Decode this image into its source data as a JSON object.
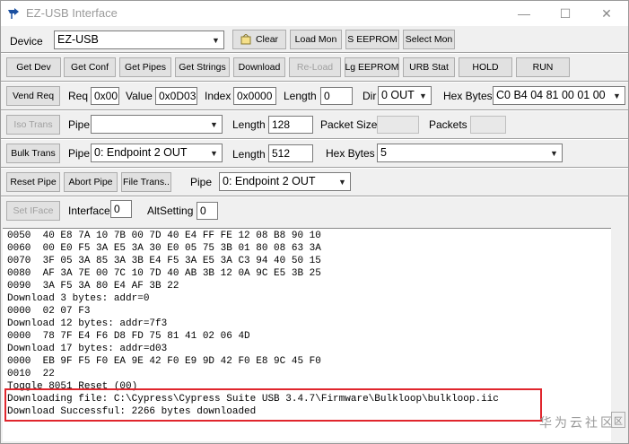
{
  "window": {
    "title": "EZ-USB Interface",
    "minimize": "—",
    "maximize": "☐",
    "close": "✕"
  },
  "row_device": {
    "device_label": "Device",
    "device_value": "EZ-USB",
    "clear_label": "Clear",
    "load_mon": "Load Mon",
    "s_eeprom": "S EEPROM",
    "select_mon": "Select Mon"
  },
  "row_get": {
    "get_dev": "Get Dev",
    "get_conf": "Get Conf",
    "get_pipes": "Get Pipes",
    "get_strings": "Get Strings",
    "download": "Download",
    "reload": "Re-Load",
    "lg_eeprom": "Lg EEPROM",
    "urb_stat": "URB Stat",
    "hold": "HOLD",
    "run": "RUN"
  },
  "row_vend": {
    "vend_req": "Vend Req",
    "req_label": "Req",
    "req_value": "0x00",
    "value_label": "Value",
    "value_value": "0x0D03",
    "index_label": "Index",
    "index_value": "0x0000",
    "length_label": "Length",
    "length_value": "0",
    "dir_label": "Dir",
    "dir_value": "0 OUT",
    "hex_label": "Hex Bytes",
    "hex_value": "C0 B4 04 81 00 01 00"
  },
  "row_iso": {
    "iso_trans": "Iso Trans",
    "pipe_label": "Pipe",
    "pipe_value": "",
    "length_label": "Length",
    "length_value": "128",
    "packet_size_label": "Packet Size",
    "packets_label": "Packets"
  },
  "row_bulk": {
    "bulk_trans": "Bulk Trans",
    "pipe_label": "Pipe",
    "pipe_value": "0: Endpoint 2 OUT",
    "length_label": "Length",
    "length_value": "512",
    "hex_label": "Hex Bytes",
    "hex_value": "5"
  },
  "row_reset": {
    "reset_pipe": "Reset Pipe",
    "abort_pipe": "Abort Pipe",
    "file_trans": "File Trans..",
    "pipe_label": "Pipe",
    "pipe_value": "0: Endpoint 2 OUT"
  },
  "row_iface": {
    "set_iface": "Set IFace",
    "interface_label": "Interface",
    "interface_value": "0",
    "altsetting_label": "AltSetting",
    "altsetting_value": "0"
  },
  "log": [
    "0050  40 E8 7A 10 7B 00 7D 40 E4 FF FE 12 08 B8 90 10",
    "0060  00 E0 F5 3A E5 3A 30 E0 05 75 3B 01 80 08 63 3A",
    "0070  3F 05 3A 85 3A 3B E4 F5 3A E5 3A C3 94 40 50 15",
    "0080  AF 3A 7E 00 7C 10 7D 40 AB 3B 12 0A 9C E5 3B 25",
    "0090  3A F5 3A 80 E4 AF 3B 22",
    "Download 3 bytes: addr=0",
    "0000  02 07 F3",
    "Download 12 bytes: addr=7f3",
    "0000  78 7F E4 F6 D8 FD 75 81 41 02 06 4D",
    "Download 17 bytes: addr=d03",
    "0000  EB 9F F5 F0 EA 9E 42 F0 E9 9D 42 F0 E8 9C 45 F0",
    "0010  22",
    "Toggle 8051 Reset (00)",
    "Downloading file: C:\\Cypress\\Cypress Suite USB 3.4.7\\Firmware\\Bulkloop\\bulkloop.iic",
    "Download Successful: 2266 bytes downloaded"
  ],
  "watermark": "华为云社区",
  "watermark_logo": "区"
}
